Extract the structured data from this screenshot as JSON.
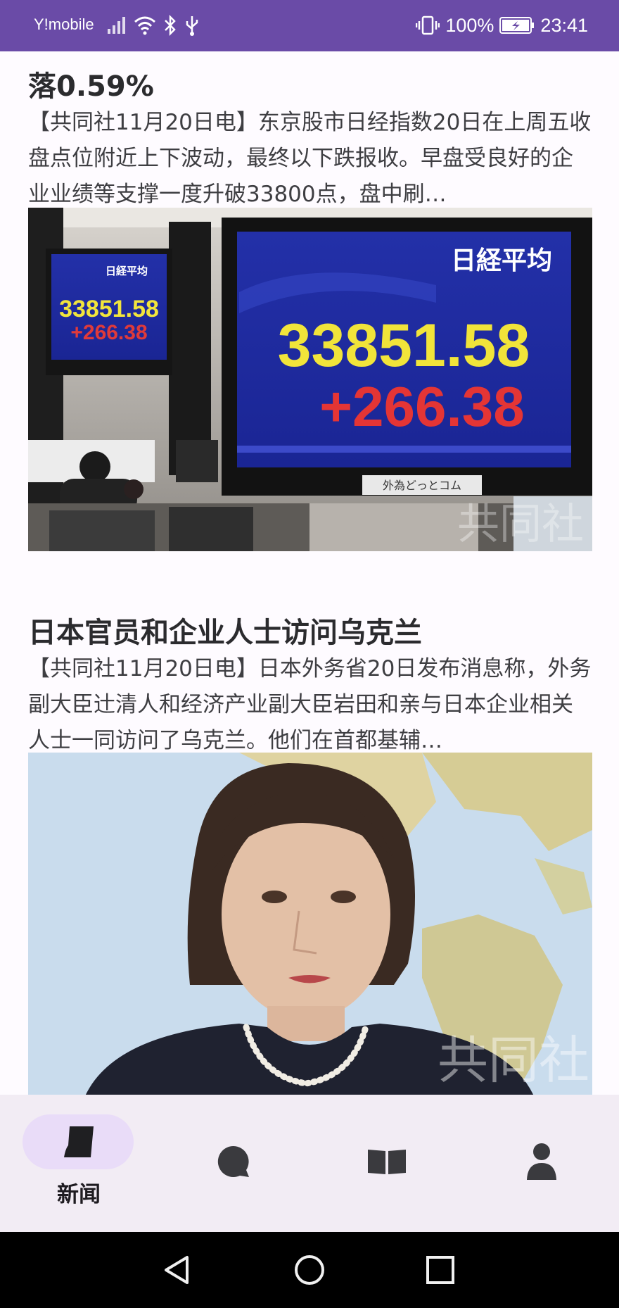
{
  "status_bar": {
    "carrier": "Y!mobile",
    "battery": "100%",
    "time": "23:41",
    "background_color": "#6a4ba7"
  },
  "articles": [
    {
      "title": "落0.59%",
      "body": "【共同社11月20日电】东京股市日经指数20日在上周五收盘点位附近上下波动，最终以下跌报收。早盘受良好的企业业绩等支撑一度升破33800点，盘中刷…",
      "image": {
        "board_title": "日経平均",
        "index_value": "33851.58",
        "change_value": "+266.38",
        "small_board_title": "日経平均",
        "small_index_value": "33851.58",
        "small_change_value": "+266.38",
        "board_footer": "外為どっとコム",
        "watermark": "共同社"
      }
    },
    {
      "title": "日本官员和企业人士访问乌克兰",
      "body": "【共同社11月20日电】日本外务省20日发布消息称，外务副大臣辻清人和经济产业副大臣岩田和亲与日本企业相关人士一同访问了乌克兰。他们在首都基辅…",
      "image": {
        "watermark": "共同社"
      }
    }
  ],
  "bottom_nav": {
    "items": [
      {
        "label": "新闻",
        "icon": "news-icon",
        "selected": true
      },
      {
        "label": "",
        "icon": "chat-icon",
        "selected": false
      },
      {
        "label": "",
        "icon": "book-icon",
        "selected": false
      },
      {
        "label": "",
        "icon": "profile-icon",
        "selected": false
      }
    ],
    "selected_pill_color": "#e9dcf8"
  },
  "system_nav": {
    "icons": [
      "back-icon",
      "home-icon",
      "recents-icon"
    ]
  }
}
